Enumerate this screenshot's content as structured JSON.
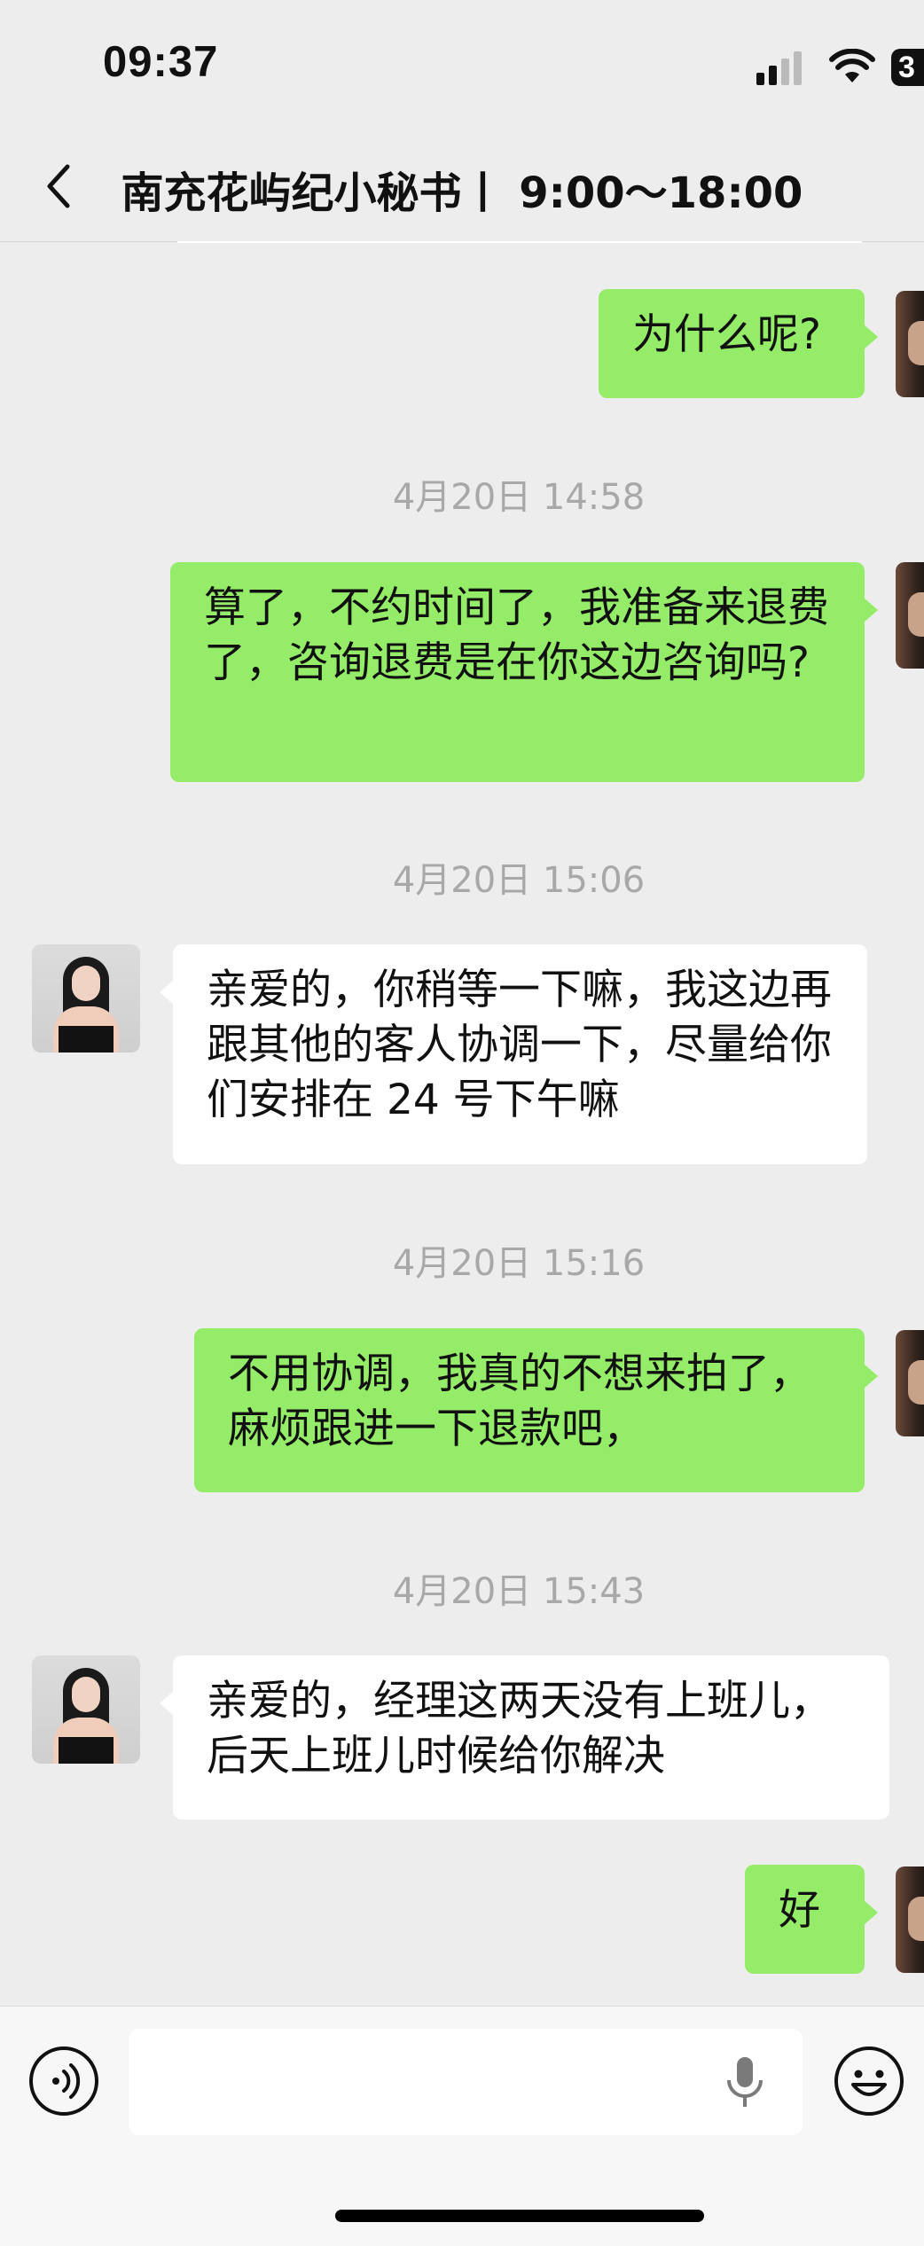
{
  "status_bar": {
    "time": "09:37",
    "battery_text": "3",
    "icons": [
      "signal-icon",
      "wifi-icon",
      "battery-icon"
    ]
  },
  "header": {
    "back_icon": "chevron-left-icon",
    "title": "南充花屿纪小秘书丨 9:00～18:00"
  },
  "messages": [
    {
      "type": "sent",
      "text": "为什么呢?"
    },
    {
      "type": "timestamp",
      "text": "4月20日 14:58"
    },
    {
      "type": "sent",
      "text": "算了，不约时间了，我准备来退费了，咨询退费是在你这边咨询吗?"
    },
    {
      "type": "timestamp",
      "text": "4月20日 15:06"
    },
    {
      "type": "received",
      "text": "亲爱的，你稍等一下嘛，我这边再跟其他的客人协调一下，尽量给你们安排在 24 号下午嘛"
    },
    {
      "type": "timestamp",
      "text": "4月20日 15:16"
    },
    {
      "type": "sent",
      "text": "不用协调，我真的不想来拍了，麻烦跟进一下退款吧，"
    },
    {
      "type": "timestamp",
      "text": "4月20日 15:43"
    },
    {
      "type": "received",
      "text": "亲爱的，经理这两天没有上班儿，后天上班儿时候给你解决"
    },
    {
      "type": "sent",
      "text": "好"
    }
  ],
  "input_bar": {
    "placeholder": "",
    "icons": [
      "voice-icon",
      "microphone-icon",
      "emoji-icon"
    ]
  },
  "colors": {
    "background": "#ededed",
    "sent_bubble": "#95ec69",
    "received_bubble": "#ffffff",
    "timestamp_text": "#a8a8a8"
  }
}
